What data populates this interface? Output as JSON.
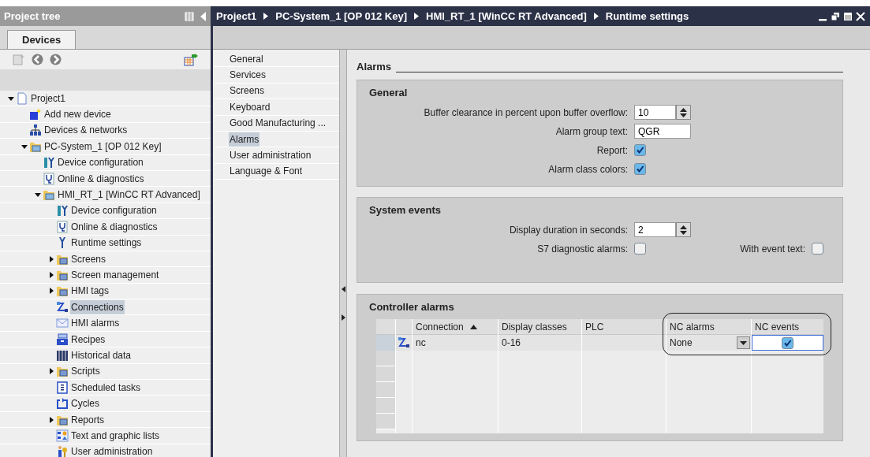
{
  "tree_panel": {
    "title": "Project tree",
    "tabs": [
      {
        "label": "Devices",
        "selected": true
      }
    ]
  },
  "tree": [
    {
      "label": "Project1",
      "kind": "project",
      "expanded": true,
      "selected": false,
      "children": [
        {
          "label": "Add new device",
          "kind": "add",
          "selected": false
        },
        {
          "label": "Devices & networks",
          "kind": "network",
          "selected": false
        },
        {
          "label": "PC-System_1 [OP 012 Key]",
          "kind": "device",
          "expanded": true,
          "selected": false,
          "children": [
            {
              "label": "Device configuration",
              "kind": "config",
              "selected": false
            },
            {
              "label": "Online & diagnostics",
              "kind": "diag",
              "selected": false
            },
            {
              "label": "HMI_RT_1 [WinCC RT Advanced]",
              "kind": "device",
              "expanded": true,
              "selected": false,
              "children": [
                {
                  "label": "Device configuration",
                  "kind": "config",
                  "selected": false
                },
                {
                  "label": "Online & diagnostics",
                  "kind": "diag",
                  "selected": false
                },
                {
                  "label": "Runtime settings",
                  "kind": "wrench",
                  "selected": false
                },
                {
                  "label": "Screens",
                  "kind": "folder",
                  "expanded": false,
                  "selected": false
                },
                {
                  "label": "Screen management",
                  "kind": "folder",
                  "expanded": false,
                  "selected": false
                },
                {
                  "label": "HMI tags",
                  "kind": "folder",
                  "expanded": false,
                  "selected": false
                },
                {
                  "label": "Connections",
                  "kind": "connection",
                  "selected": true
                },
                {
                  "label": "HMI alarms",
                  "kind": "mail",
                  "selected": false
                },
                {
                  "label": "Recipes",
                  "kind": "recipe",
                  "selected": false
                },
                {
                  "label": "Historical data",
                  "kind": "archive",
                  "selected": false
                },
                {
                  "label": "Scripts",
                  "kind": "folder",
                  "expanded": false,
                  "selected": false
                },
                {
                  "label": "Scheduled tasks",
                  "kind": "task",
                  "selected": false
                },
                {
                  "label": "Cycles",
                  "kind": "cycle",
                  "selected": false
                },
                {
                  "label": "Reports",
                  "kind": "folder",
                  "expanded": false,
                  "selected": false
                },
                {
                  "label": "Text and graphic lists",
                  "kind": "list",
                  "selected": false
                },
                {
                  "label": "User administration",
                  "kind": "users",
                  "selected": false
                }
              ]
            }
          ]
        }
      ]
    }
  ],
  "breadcrumb": [
    "Project1",
    "PC-System_1 [OP 012 Key]",
    "HMI_RT_1 [WinCC RT Advanced]",
    "Runtime settings"
  ],
  "nav": [
    {
      "label": "General",
      "selected": false
    },
    {
      "label": "Services",
      "selected": false
    },
    {
      "label": "Screens",
      "selected": false
    },
    {
      "label": "Keyboard",
      "selected": false
    },
    {
      "label": "Good Manufacturing ...",
      "selected": false
    },
    {
      "label": "Alarms",
      "selected": true
    },
    {
      "label": "User administration",
      "selected": false
    },
    {
      "label": "Language & Font",
      "selected": false
    }
  ],
  "page_title": "Alarms",
  "general": {
    "title": "General",
    "fields": [
      {
        "kind": "spin",
        "label": "Buffer clearance in percent upon buffer overflow:",
        "value": "10"
      },
      {
        "kind": "text",
        "label": "Alarm group text:",
        "value": "QGR"
      },
      {
        "kind": "checkbox",
        "label": "Report:",
        "checked": true
      },
      {
        "kind": "checkbox",
        "label": "Alarm class colors:",
        "checked": true
      }
    ]
  },
  "system_events": {
    "title": "System events",
    "duration": {
      "label": "Display duration in seconds:",
      "value": "2"
    },
    "s7_diagnostic": {
      "label": "S7 diagnostic alarms:",
      "checked": false
    },
    "with_event_text": {
      "label": "With event text:",
      "checked": false
    }
  },
  "controller_alarms": {
    "title": "Controller alarms",
    "columns": [
      {
        "label": "Connection",
        "sorted": true
      },
      {
        "label": "Display classes",
        "sorted": false
      },
      {
        "label": "PLC",
        "sorted": false
      },
      {
        "label": "NC alarms",
        "sorted": false
      },
      {
        "label": "NC events",
        "sorted": false
      }
    ],
    "rows": [
      {
        "connection": "nc",
        "display_classes": "0-16",
        "nc_alarms": "None",
        "nc_events": true
      }
    ]
  }
}
